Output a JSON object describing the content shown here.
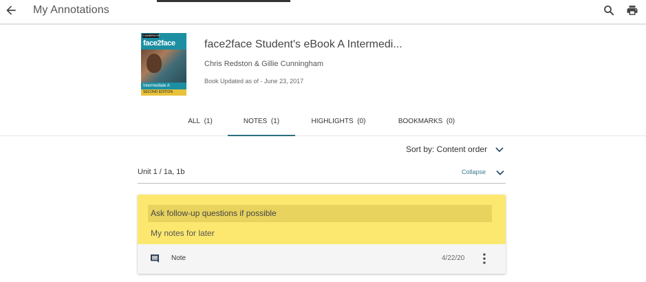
{
  "header": {
    "title": "My Annotations",
    "back_icon": "arrow-left-icon",
    "search_icon": "search-icon",
    "print_icon": "print-icon"
  },
  "book": {
    "title": "face2face Student's eBook A Intermedi...",
    "authors": "Chris Redston & Gillie Cunningham",
    "updated": "Book Updated as of - June 23, 2017",
    "cover": {
      "brand": "CAMBRIDGE",
      "title": "face2face",
      "level": "Intermediate A",
      "edition": "SECOND EDITION"
    }
  },
  "tabs": [
    {
      "label": "ALL",
      "count": "(1)",
      "active": false
    },
    {
      "label": "NOTES",
      "count": "(1)",
      "active": true
    },
    {
      "label": "HIGHLIGHTS",
      "count": "(0)",
      "active": false
    },
    {
      "label": "BOOKMARKS",
      "count": "(0)",
      "active": false
    }
  ],
  "sort": {
    "label": "Sort by: Content order"
  },
  "unit": {
    "label": "Unit 1 / 1a, 1b",
    "collapse_label": "Collapse"
  },
  "note_card": {
    "highlighted_text": "Ask follow-up questions if possible",
    "note_text": "My notes for later",
    "type_label": "Note",
    "date": "4/22/20",
    "highlight_color": "#fce86f",
    "icon": "comment-icon"
  },
  "colors": {
    "accent": "#2c6e80",
    "link": "#3a7a8c",
    "note_yellow": "#fce86f",
    "highlight_yellow": "#e8d35e"
  }
}
